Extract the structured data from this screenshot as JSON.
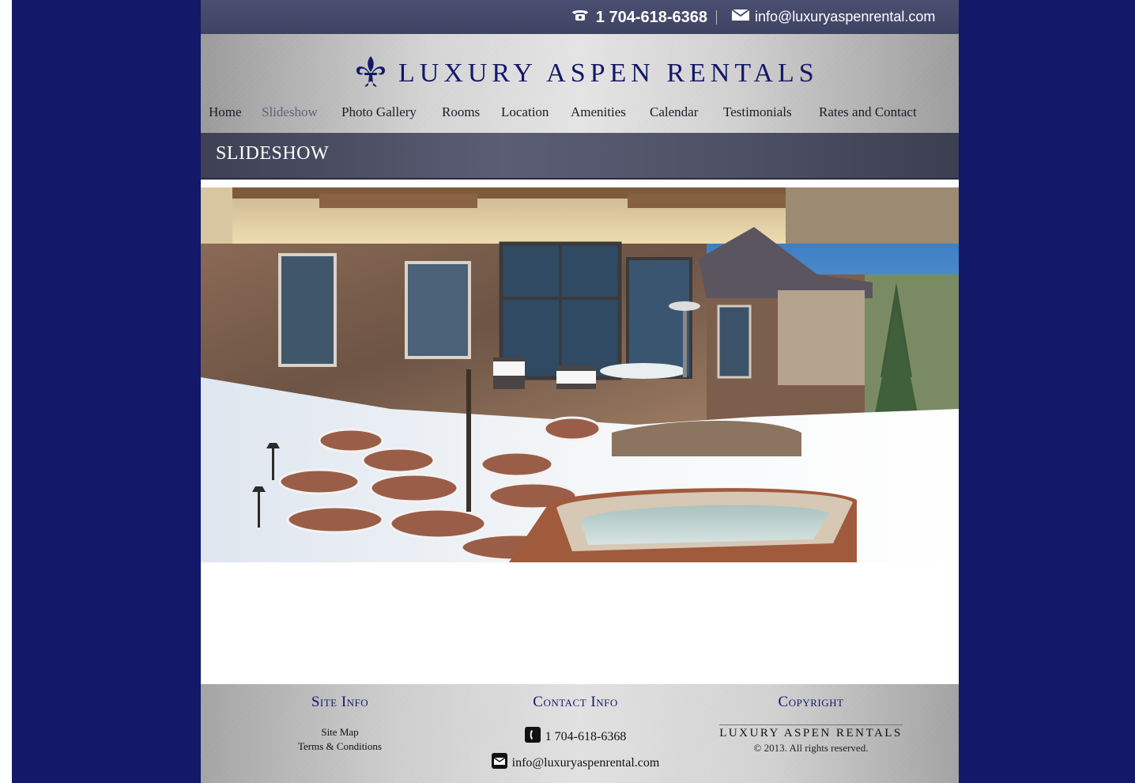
{
  "topbar": {
    "phone": "1 704-618-6368",
    "email": "info@luxuryaspenrental.com"
  },
  "brand": {
    "name": "LUXURY ASPEN RENTALS",
    "logo_icon": "fleur-de-lis-icon",
    "color": "#141868"
  },
  "nav": {
    "items": [
      {
        "label": "Home"
      },
      {
        "label": "Slideshow",
        "active": true
      },
      {
        "label": "Photo Gallery"
      },
      {
        "label": "Rooms"
      },
      {
        "label": "Location"
      },
      {
        "label": "Amenities"
      },
      {
        "label": "Calendar"
      },
      {
        "label": "Testimonials"
      },
      {
        "label": "Rates and Contact"
      }
    ]
  },
  "page": {
    "title": "SLIDESHOW"
  },
  "footer": {
    "site_info": {
      "heading": "Site Info",
      "links": [
        "Site Map",
        "Terms & Conditions"
      ]
    },
    "contact_info": {
      "heading": "Contact Info",
      "phone": "1 704-618-6368",
      "email": "info@luxuryaspenrental.com"
    },
    "copyright": {
      "heading": "Copyright",
      "brand": "LUXURY ASPEN RENTALS",
      "text": "© 2013. All rights reserved."
    }
  },
  "colors": {
    "outer_background": "#141868",
    "topbar": "#454969",
    "accent": "#141868"
  }
}
